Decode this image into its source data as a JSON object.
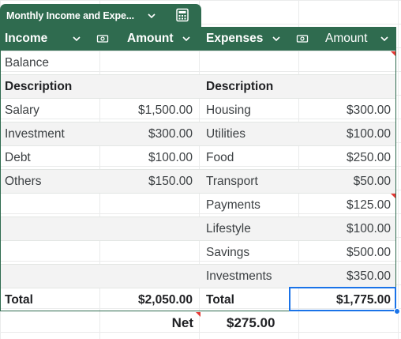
{
  "table": {
    "name": "Monthly Income and Expe..."
  },
  "header": {
    "income": "Income",
    "income_amount": "Amount",
    "expenses": "Expenses",
    "expenses_amount": "Amount"
  },
  "rows": {
    "balance": "Balance",
    "description_left": "Description",
    "description_right": "Description",
    "income_items": [
      {
        "label": "Salary",
        "amount": "$1,500.00"
      },
      {
        "label": "Investment",
        "amount": "$300.00"
      },
      {
        "label": "Debt",
        "amount": "$100.00"
      },
      {
        "label": "Others",
        "amount": "$150.00"
      }
    ],
    "expense_items": [
      {
        "label": "Housing",
        "amount": "$300.00"
      },
      {
        "label": "Utilities",
        "amount": "$100.00"
      },
      {
        "label": "Food",
        "amount": "$250.00"
      },
      {
        "label": "Transport",
        "amount": "$50.00"
      },
      {
        "label": "Payments",
        "amount": "$125.00"
      },
      {
        "label": "Lifestyle",
        "amount": "$100.00"
      },
      {
        "label": "Savings",
        "amount": "$500.00"
      },
      {
        "label": "Investments",
        "amount": "$350.00"
      }
    ],
    "total_label_left": "Total",
    "total_income": "$2,050.00",
    "total_label_right": "Total",
    "total_expenses": "$1,775.00"
  },
  "net": {
    "label": "Net",
    "value": "$275.00"
  },
  "colors": {
    "header_green": "#2f6b4f",
    "selection_blue": "#1a73e8",
    "note_red": "#e53935",
    "stripe": "#f3f3f3"
  },
  "icons": [
    "chevron-down-icon",
    "calculator-icon",
    "money-chip-icon"
  ]
}
